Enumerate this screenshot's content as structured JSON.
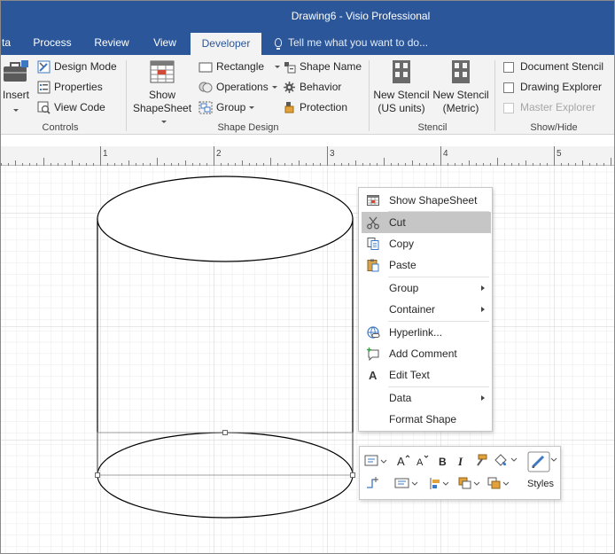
{
  "window": {
    "title": "Drawing6 - Visio Professional"
  },
  "tabs": [
    {
      "label": "ta",
      "active": false
    },
    {
      "label": "Process",
      "active": false
    },
    {
      "label": "Review",
      "active": false
    },
    {
      "label": "View",
      "active": false
    },
    {
      "label": "Developer",
      "active": true
    }
  ],
  "tell_me": "Tell me what you want to do...",
  "ribbon": {
    "controls": {
      "insert": "Insert",
      "design_mode": "Design Mode",
      "properties": "Properties",
      "view_code": "View Code",
      "group_label": "Controls"
    },
    "shape_design": {
      "show_shapesheet_line1": "Show",
      "show_shapesheet_line2": "ShapeSheet",
      "rectangle": "Rectangle",
      "operations": "Operations",
      "group": "Group",
      "shape_name": "Shape Name",
      "behavior": "Behavior",
      "protection": "Protection",
      "group_label": "Shape Design"
    },
    "stencil": {
      "new_stencil_us_line1": "New Stencil",
      "new_stencil_us_line2": "(US units)",
      "new_stencil_metric_line1": "New Stencil",
      "new_stencil_metric_line2": "(Metric)",
      "group_label": "Stencil"
    },
    "show_hide": {
      "document_stencil": "Document Stencil",
      "drawing_explorer": "Drawing Explorer",
      "master_explorer": "Master Explorer",
      "group_label": "Show/Hide"
    }
  },
  "ruler": {
    "labels": [
      "1",
      "2",
      "3",
      "4",
      "5"
    ]
  },
  "context_menu": {
    "items": [
      {
        "label": "Show ShapeSheet",
        "icon": "shapesheet-icon",
        "submenu": false,
        "highlighted": false
      },
      {
        "label": "Cut",
        "icon": "scissors-icon",
        "submenu": false,
        "highlighted": true
      },
      {
        "label": "Copy",
        "icon": "copy-icon",
        "submenu": false,
        "highlighted": false
      },
      {
        "label": "Paste",
        "icon": "paste-icon",
        "submenu": false,
        "highlighted": false
      },
      {
        "label": "Group",
        "icon": "",
        "submenu": true,
        "highlighted": false
      },
      {
        "label": "Container",
        "icon": "",
        "submenu": true,
        "highlighted": false
      },
      {
        "label": "Hyperlink...",
        "icon": "hyperlink-icon",
        "submenu": false,
        "highlighted": false
      },
      {
        "label": "Add Comment",
        "icon": "comment-icon",
        "submenu": false,
        "highlighted": false
      },
      {
        "label": "Edit Text",
        "icon": "text-icon",
        "submenu": false,
        "highlighted": false
      },
      {
        "label": "Data",
        "icon": "",
        "submenu": true,
        "highlighted": false
      },
      {
        "label": "Format Shape",
        "icon": "",
        "submenu": false,
        "highlighted": false
      }
    ]
  },
  "mini_toolbar": {
    "styles_label": "Styles"
  },
  "colors": {
    "accent": "#2b579a",
    "highlight": "#c6c6c6"
  }
}
